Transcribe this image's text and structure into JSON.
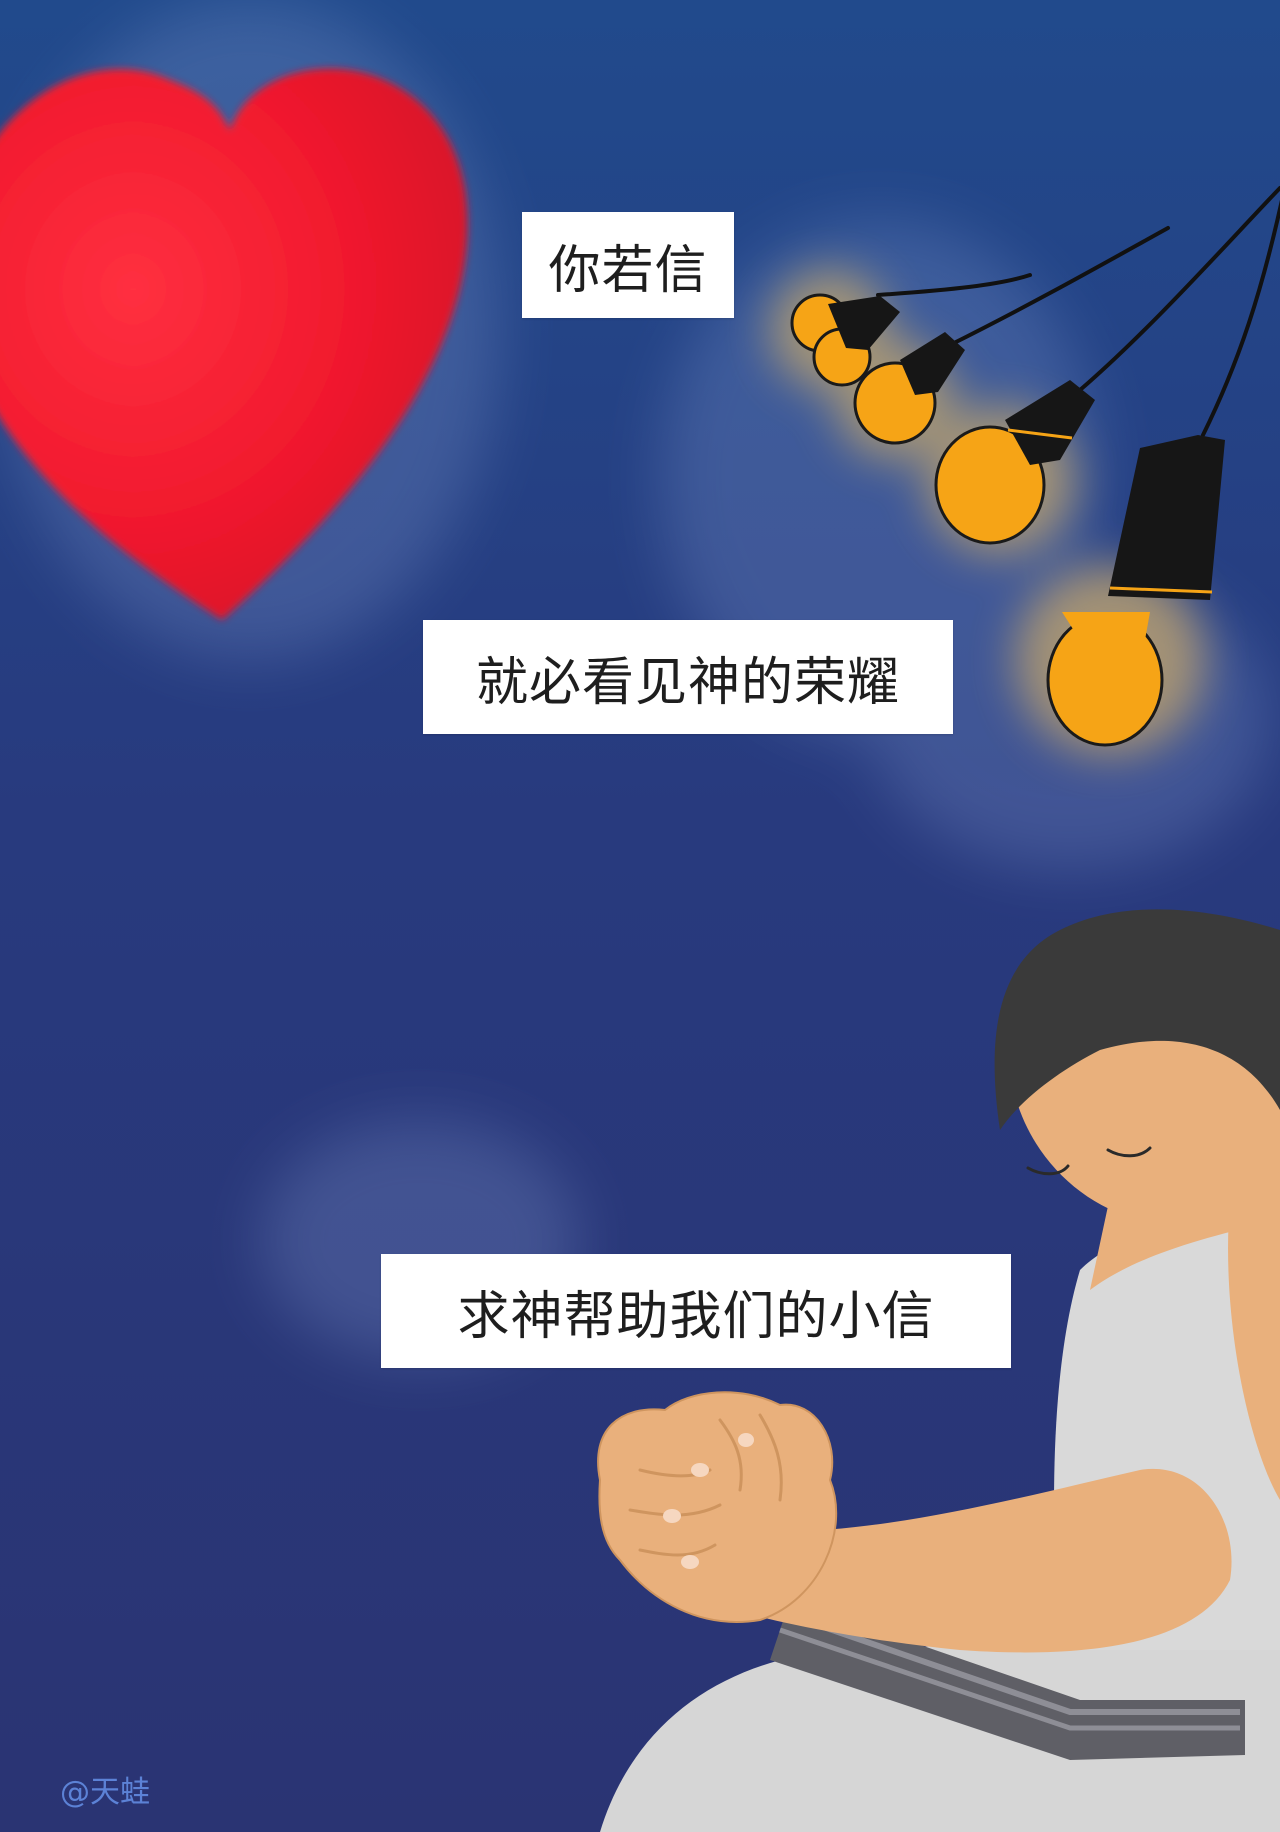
{
  "captions": {
    "line1": "你若信",
    "line2": "就必看见神的荣耀",
    "line3": "求神帮助我们的小信"
  },
  "watermark": "@天蛙",
  "colors": {
    "background_top": "#214a8c",
    "background_mid": "#283a7e",
    "background_bottom": "#2a3473",
    "heart": "#f1192d",
    "bulb": "#f6a416",
    "bulb_cap": "#161616",
    "skin": "#e9b07c",
    "hair": "#3a3a3a",
    "shirt": "#d9d9d9",
    "book": "#5f5f66",
    "caption_background": "#ffffff",
    "caption_text": "#1e1e1e",
    "watermark": "#5c82d6"
  },
  "illustration": {
    "heart": "red-heart",
    "lights": "hanging-light-bulbs",
    "person": "praying-person-with-book"
  }
}
